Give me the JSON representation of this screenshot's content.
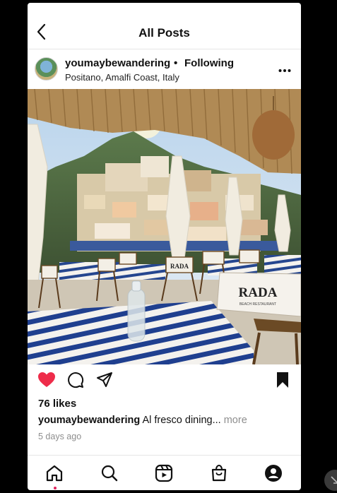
{
  "header": {
    "title": "All Posts",
    "back_icon": "chevron-left-icon"
  },
  "post": {
    "username": "youmaybewandering",
    "separator": "•",
    "follow_status": "Following",
    "location": "Positano, Amalfi Coast, Italy",
    "more_icon": "more-horizontal-icon",
    "photo": {
      "sign_text": "RADA",
      "sign_subtext": "BEACH RESTAURANT",
      "chair_text": "RADA"
    },
    "actions": {
      "liked": true,
      "like_color": "#ee2c4a",
      "saved": true
    },
    "likes": "76 likes",
    "caption_user": "youmaybewandering",
    "caption_text": " Al fresco dining... ",
    "caption_more": "more",
    "time_ago": "5 days ago"
  },
  "bottom_nav": {
    "items": [
      "home-icon",
      "search-icon",
      "reels-icon",
      "shop-icon",
      "profile-icon"
    ],
    "active": "home-icon"
  }
}
